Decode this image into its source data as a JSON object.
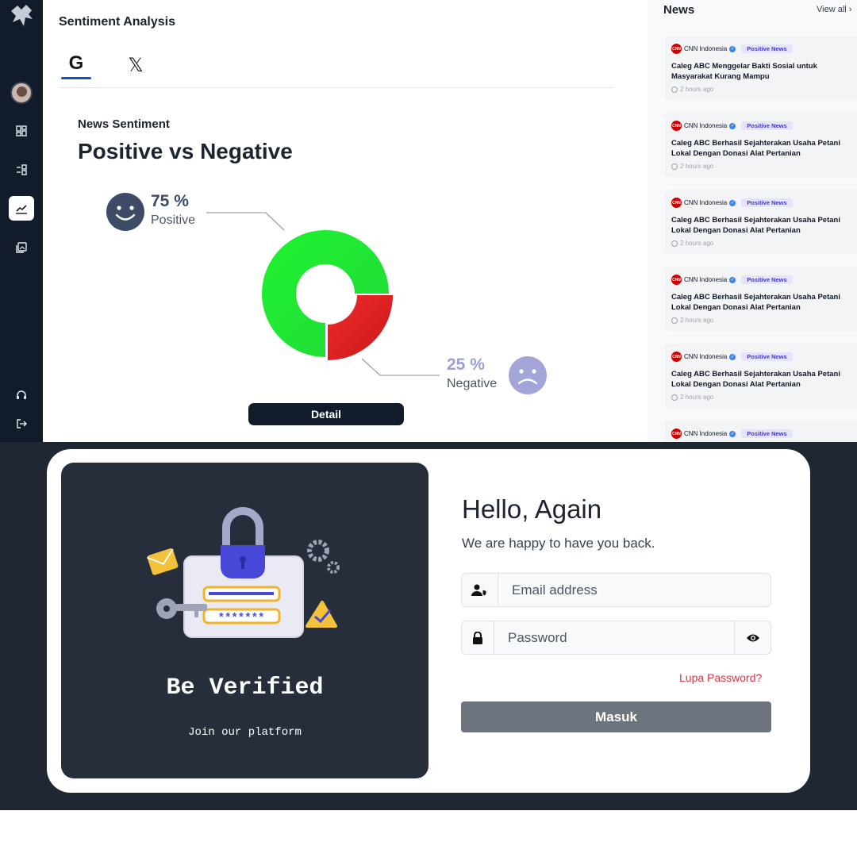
{
  "dashboard": {
    "page_title": "Sentiment Analysis",
    "tabs": [
      {
        "label": "G",
        "icon": "google-icon",
        "active": true
      },
      {
        "label": "𝕏",
        "icon": "x-twitter-icon",
        "active": false
      }
    ],
    "section_label": "News Sentiment",
    "section_title": "Positive vs Negative",
    "positive": {
      "percent": "75 %",
      "label": "Positive",
      "color": "#3d4b66"
    },
    "negative": {
      "percent": "25 %",
      "label": "Negative",
      "color": "#9c9fd6"
    },
    "detail_button": "Detail"
  },
  "chart_data": {
    "type": "pie",
    "categories": [
      "Positive",
      "Negative"
    ],
    "values": [
      75,
      25
    ],
    "colors": [
      "#16e02e",
      "#e02222"
    ],
    "title": "Positive vs Negative"
  },
  "sidebar": {
    "items": [
      {
        "name": "dashboard",
        "icon": "grid-icon"
      },
      {
        "name": "list",
        "icon": "list-icon"
      },
      {
        "name": "analytics",
        "icon": "chart-icon",
        "active": true
      },
      {
        "name": "gallery",
        "icon": "gallery-icon"
      },
      {
        "name": "support",
        "icon": "headset-icon"
      },
      {
        "name": "logout",
        "icon": "logout-icon"
      }
    ]
  },
  "news": {
    "title": "News",
    "view_all": "View all",
    "items": [
      {
        "source": "CNN Indonesia",
        "badge": "Positive News",
        "title": "Caleg ABC Menggelar Bakti Sosial untuk Masyarakat Kurang Mampu",
        "time": "2 hours ago"
      },
      {
        "source": "CNN Indonesia",
        "badge": "Positive News",
        "title": "Caleg ABC Berhasil Sejahterakan Usaha Petani Lokal Dengan Donasi Alat Pertanian",
        "time": "2 hours ago"
      },
      {
        "source": "CNN Indonesia",
        "badge": "Positive News",
        "title": "Caleg ABC Berhasil Sejahterakan Usaha Petani Lokal Dengan Donasi Alat Pertanian",
        "time": "2 hours ago"
      },
      {
        "source": "CNN Indonesia",
        "badge": "Positive News",
        "title": "Caleg ABC Berhasil Sejahterakan Usaha Petani Lokal Dengan Donasi Alat Pertanian",
        "time": "2 hours ago"
      },
      {
        "source": "CNN Indonesia",
        "badge": "Positive News",
        "title": "Caleg ABC Berhasil Sejahterakan Usaha Petani Lokal Dengan Donasi Alat Pertanian",
        "time": "2 hours ago"
      },
      {
        "source": "CNN Indonesia",
        "badge": "Positive News",
        "title": "",
        "time": ""
      }
    ]
  },
  "login": {
    "heading": "Be Verified",
    "subheading": "Join our platform",
    "password_mask": "*******",
    "title": "Hello, Again",
    "subtitle": "We are happy to have you back.",
    "email_placeholder": "Email address",
    "password_placeholder": "Password",
    "forgot": "Lupa Password?",
    "submit": "Masuk"
  }
}
